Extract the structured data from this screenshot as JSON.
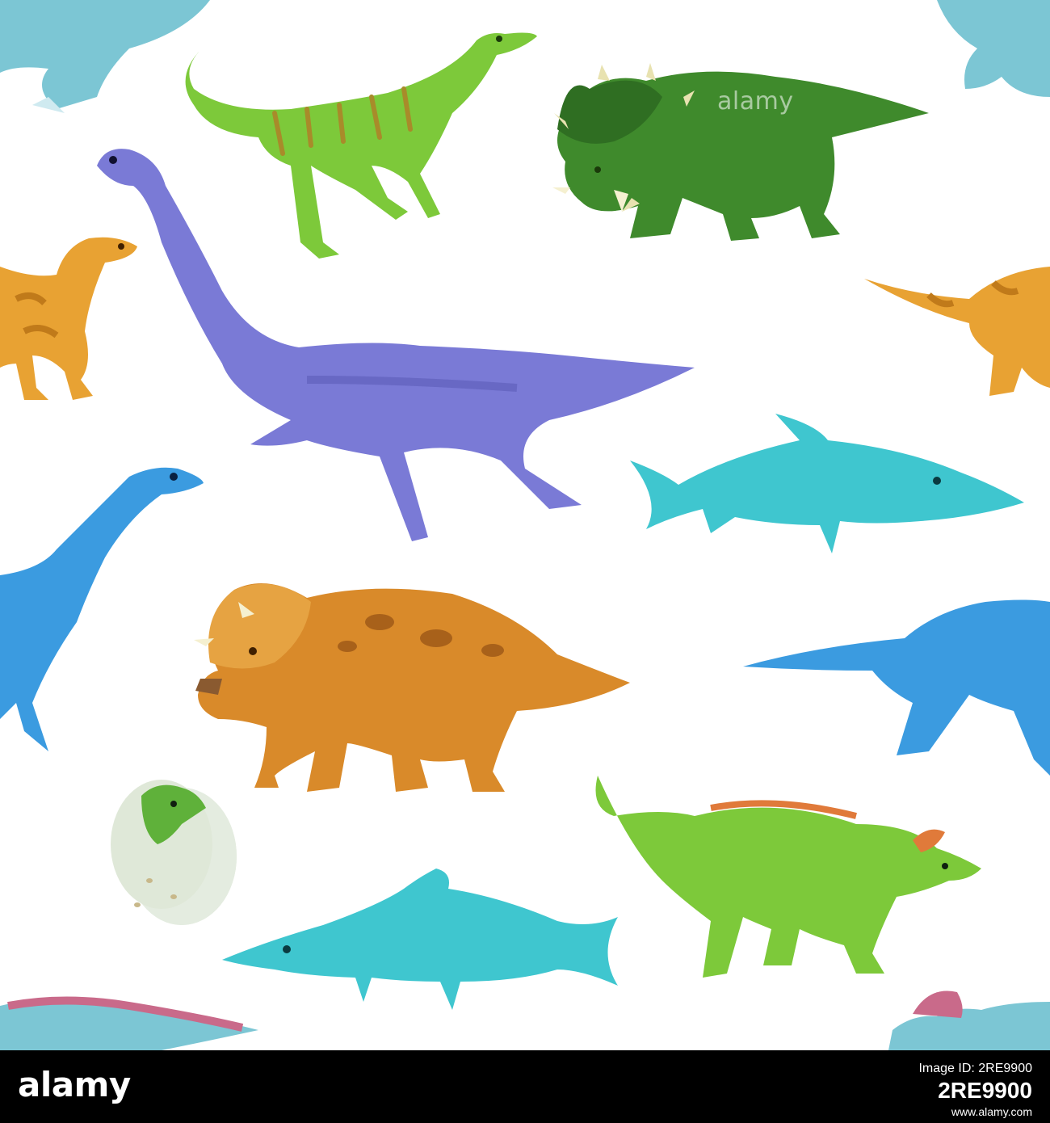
{
  "watermark": {
    "text": "alamy"
  },
  "footer": {
    "logo": "alamy",
    "image_id_label": "Image ID: 2RE9900",
    "image_id": "2RE9900",
    "url": "www.alamy.com"
  },
  "colors": {
    "background": "#ffffff",
    "footer": "#000000",
    "green_dino": "#7dc93a",
    "dark_green_triceratops": "#3f8a2c",
    "purple_plesiosaur": "#7a7ad6",
    "orange_dino": "#e8a233",
    "cyan_ichthyosaur": "#3fc6cf",
    "blue_plesiosaur": "#3b9be0",
    "orange_triceratops": "#d98a2a"
  }
}
